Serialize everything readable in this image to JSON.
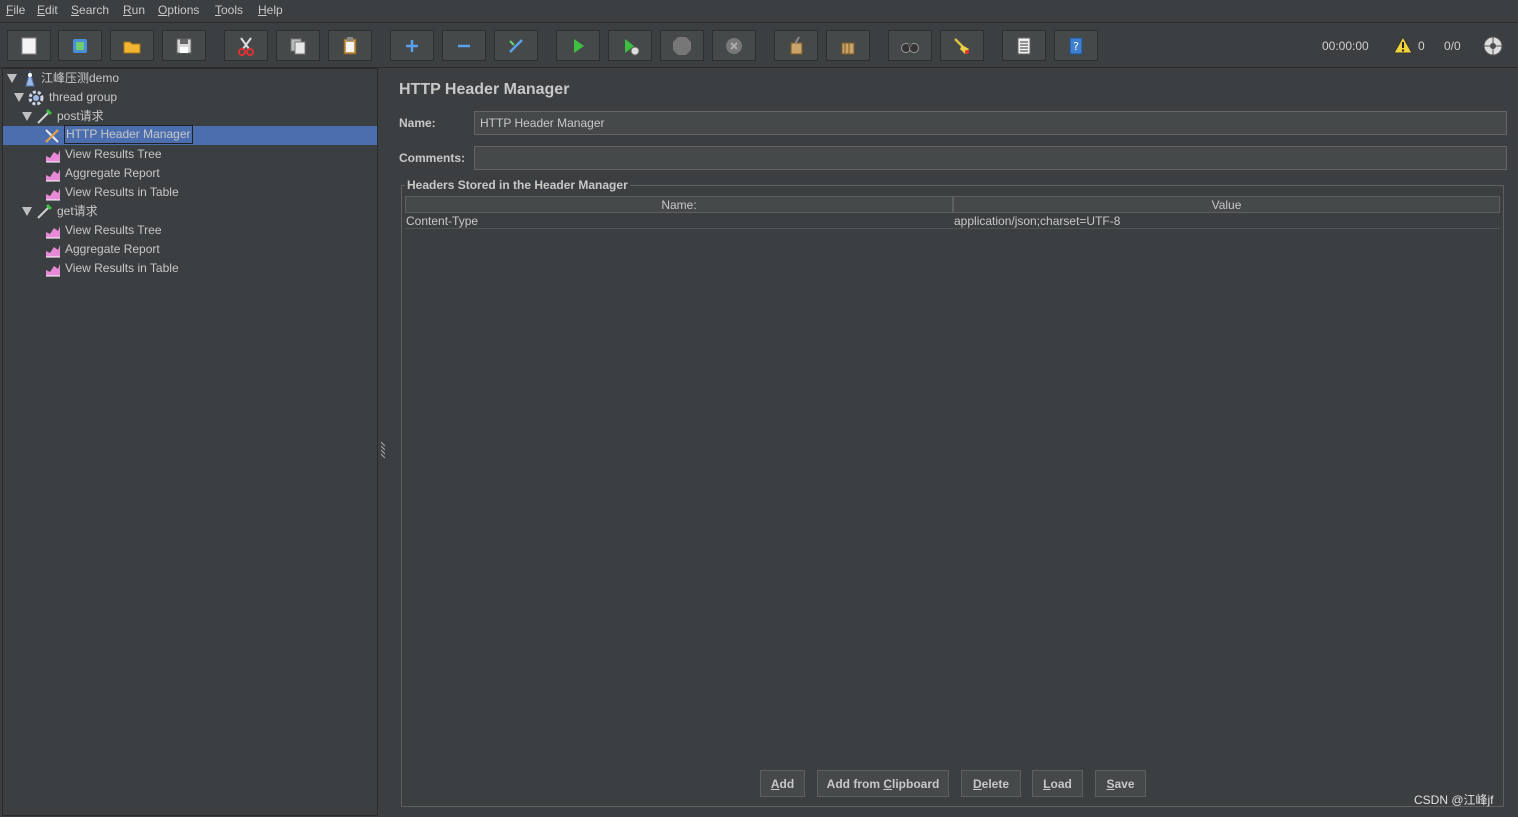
{
  "menu": [
    {
      "u": "F",
      "rest": "ile"
    },
    {
      "u": "E",
      "rest": "dit"
    },
    {
      "u": "S",
      "rest": "earch"
    },
    {
      "u": "R",
      "rest": "un"
    },
    {
      "u": "O",
      "rest": "ptions"
    },
    {
      "u": "T",
      "rest": "ools"
    },
    {
      "u": "H",
      "rest": "elp"
    }
  ],
  "toolbar": {
    "timer": "00:00:00",
    "warning_count": "0",
    "threads": "0/0"
  },
  "tree": [
    {
      "label": "江峰压测demo",
      "icon": "test-plan-icon"
    },
    {
      "label": "thread group",
      "icon": "gear-icon"
    },
    {
      "label": "post请求",
      "icon": "sampler-icon"
    },
    {
      "label": "HTTP Header Manager",
      "icon": "header-manager-icon"
    },
    {
      "label": "View Results Tree",
      "icon": "listener-icon"
    },
    {
      "label": "Aggregate Report",
      "icon": "listener-icon"
    },
    {
      "label": "View Results in Table",
      "icon": "listener-icon"
    },
    {
      "label": "get请求",
      "icon": "sampler-icon"
    },
    {
      "label": "View Results Tree",
      "icon": "listener-icon"
    },
    {
      "label": "Aggregate Report",
      "icon": "listener-icon"
    },
    {
      "label": "View Results in Table",
      "icon": "listener-icon"
    }
  ],
  "panel": {
    "title": "HTTP Header Manager",
    "name_label": "Name:",
    "name_value": "HTTP Header Manager",
    "comments_label": "Comments:",
    "comments_value": "",
    "group_title": "Headers Stored in the Header Manager",
    "columns": [
      "Name:",
      "Value"
    ],
    "rows": [
      {
        "name": "Content-Type",
        "value": "application/json;charset=UTF-8"
      }
    ],
    "buttons": [
      {
        "u": "A",
        "rest": "dd"
      },
      {
        "pre": "Add from ",
        "u": "C",
        "rest": "lipboard"
      },
      {
        "u": "D",
        "rest": "elete"
      },
      {
        "u": "L",
        "rest": "oad"
      },
      {
        "u": "S",
        "rest": "ave"
      }
    ]
  },
  "watermark": "CSDN @江峰jf"
}
